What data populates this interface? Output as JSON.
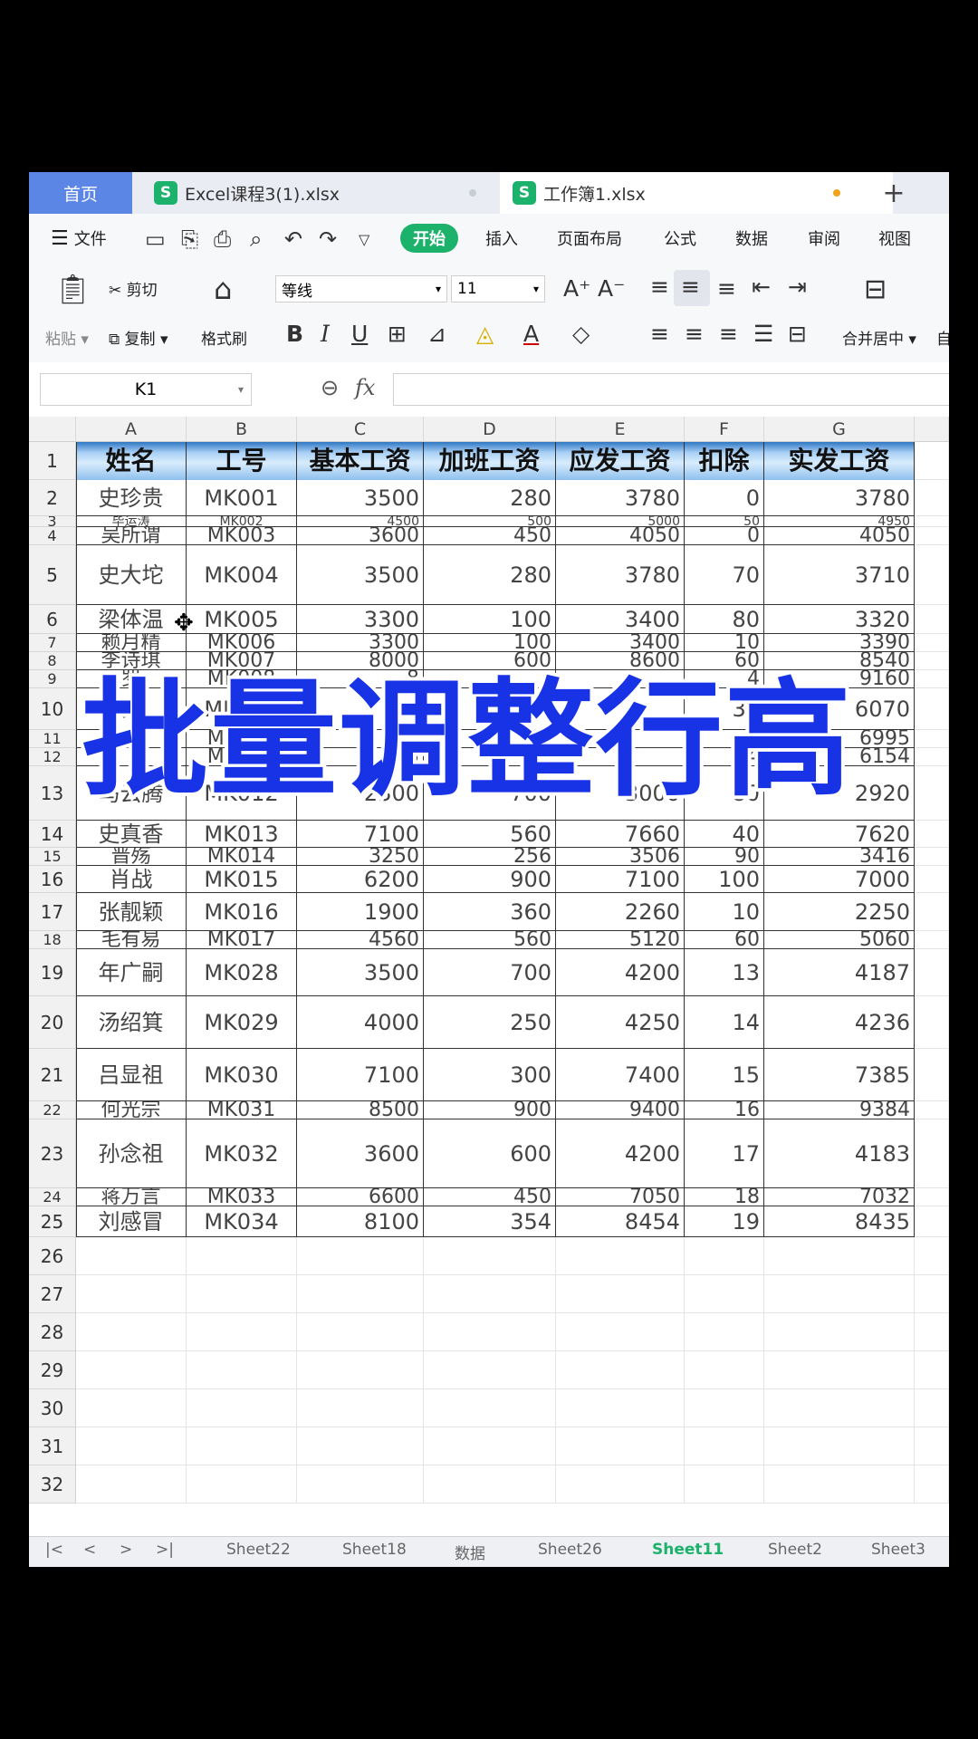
{
  "tabs": {
    "home": "首页",
    "file1": "Excel课程3(1).xlsx",
    "file2": "工作簿1.xlsx",
    "add": "+"
  },
  "menu": {
    "file": "文件",
    "items": [
      "开始",
      "插入",
      "页面布局",
      "公式",
      "数据",
      "审阅",
      "视图"
    ]
  },
  "ribbon": {
    "cut": "剪切",
    "paste": "粘贴",
    "copy": "复制",
    "format_painter": "格式刷",
    "font_name": "等线",
    "font_size": "11",
    "merge_center": "合并居中",
    "auto": "自"
  },
  "formula_bar": {
    "name_box": "K1",
    "fx": "fx",
    "value": ""
  },
  "grid": {
    "columns": [
      "A",
      "B",
      "C",
      "D",
      "E",
      "F",
      "G"
    ],
    "headers": [
      "姓名",
      "工号",
      "基本工资",
      "加班工资",
      "应发工资",
      "扣除",
      "实发工资"
    ],
    "rows": [
      [
        "史珍贵",
        "MK001",
        "3500",
        "280",
        "3780",
        "0",
        "3780"
      ],
      [
        "毕运涛",
        "MK002",
        "4500",
        "500",
        "5000",
        "50",
        "4950"
      ],
      [
        "吴所谓",
        "MK003",
        "3600",
        "450",
        "4050",
        "0",
        "4050"
      ],
      [
        "史大坨",
        "MK004",
        "3500",
        "280",
        "3780",
        "70",
        "3710"
      ],
      [
        "梁体温",
        "MK005",
        "3300",
        "100",
        "3400",
        "80",
        "3320"
      ],
      [
        "赖月精",
        "MK006",
        "3300",
        "100",
        "3400",
        "10",
        "3390"
      ],
      [
        "李诗琪",
        "MK007",
        "8000",
        "600",
        "8600",
        "60",
        "8540"
      ],
      [
        "罗",
        "MK008",
        "8",
        "",
        "",
        "4",
        "9160"
      ],
      [
        "易",
        "MK009",
        "6",
        "",
        "",
        "30",
        "6070"
      ],
      [
        "朱",
        "MK010",
        "6",
        "",
        "",
        "",
        "6995"
      ],
      [
        "",
        "MK011",
        "5",
        "",
        "",
        "4",
        "6154"
      ],
      [
        "马云腾",
        "MK012",
        "2300",
        "700",
        "3000",
        "80",
        "2920"
      ],
      [
        "史真香",
        "MK013",
        "7100",
        "560",
        "7660",
        "40",
        "7620"
      ],
      [
        "晋殇",
        "MK014",
        "3250",
        "256",
        "3506",
        "90",
        "3416"
      ],
      [
        "肖战",
        "MK015",
        "6200",
        "900",
        "7100",
        "100",
        "7000"
      ],
      [
        "张靓颖",
        "MK016",
        "1900",
        "360",
        "2260",
        "10",
        "2250"
      ],
      [
        "毛有易",
        "MK017",
        "4560",
        "560",
        "5120",
        "60",
        "5060"
      ],
      [
        "年广嗣",
        "MK028",
        "3500",
        "700",
        "4200",
        "13",
        "4187"
      ],
      [
        "汤绍箕",
        "MK029",
        "4000",
        "250",
        "4250",
        "14",
        "4236"
      ],
      [
        "吕显祖",
        "MK030",
        "7100",
        "300",
        "7400",
        "15",
        "7385"
      ],
      [
        "何光宗",
        "MK031",
        "8500",
        "900",
        "9400",
        "16",
        "9384"
      ],
      [
        "孙念祖",
        "MK032",
        "3600",
        "600",
        "4200",
        "17",
        "4183"
      ],
      [
        "蒋万言",
        "MK033",
        "6600",
        "450",
        "7050",
        "18",
        "7032"
      ],
      [
        "刘感冒",
        "MK034",
        "8100",
        "354",
        "8454",
        "19",
        "8435"
      ]
    ],
    "empty_rows": [
      "26",
      "27",
      "28",
      "29",
      "30",
      "31",
      "32"
    ]
  },
  "sheets": [
    "Sheet22",
    "Sheet18",
    "数据",
    "Sheet26",
    "Sheet11",
    "Sheet2",
    "Sheet3"
  ],
  "overlay_title": "批量调整行高",
  "colors": {
    "accent_green": "#1db26b",
    "home_tab": "#5b86e5",
    "overlay_text": "#1832e6"
  }
}
